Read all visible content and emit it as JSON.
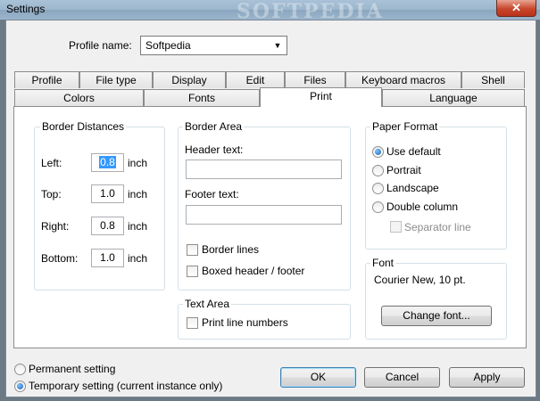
{
  "window": {
    "title": "Settings",
    "close_symbol": "✕",
    "watermark": "SOFTPEDIA"
  },
  "profile": {
    "label": "Profile name:",
    "value": "Softpedia"
  },
  "tabs": {
    "row1": [
      "Profile",
      "File type",
      "Display",
      "Edit",
      "Files",
      "Keyboard macros",
      "Shell"
    ],
    "row2": [
      "Colors",
      "Fonts",
      "Print",
      "Language"
    ],
    "active": "Print"
  },
  "border_distances": {
    "title": "Border Distances",
    "unit": "inch",
    "rows": [
      {
        "label": "Left:",
        "value": "0.8"
      },
      {
        "label": "Top:",
        "value": "1.0"
      },
      {
        "label": "Right:",
        "value": "0.8"
      },
      {
        "label": "Bottom:",
        "value": "1.0"
      }
    ]
  },
  "border_area": {
    "title": "Border Area",
    "header_label": "Header text:",
    "header_value": "",
    "footer_label": "Footer text:",
    "footer_value": "",
    "border_lines": "Border lines",
    "boxed": "Boxed header / footer"
  },
  "text_area": {
    "title": "Text Area",
    "print_line_numbers": "Print line numbers"
  },
  "paper_format": {
    "title": "Paper Format",
    "options": [
      "Use default",
      "Portrait",
      "Landscape",
      "Double column"
    ],
    "selected": "Use default",
    "separator": "Separator line"
  },
  "font": {
    "title": "Font",
    "value": "Courier New,  10 pt.",
    "change_button": "Change font..."
  },
  "setting_mode": {
    "permanent": "Permanent setting",
    "temporary": "Temporary setting (current instance only)",
    "selected": "temporary"
  },
  "buttons": {
    "ok": "OK",
    "cancel": "Cancel",
    "apply": "Apply"
  },
  "colors": {
    "selection": "#3399ff",
    "title_bar": "#9cb6cc",
    "close": "#c7462c"
  }
}
